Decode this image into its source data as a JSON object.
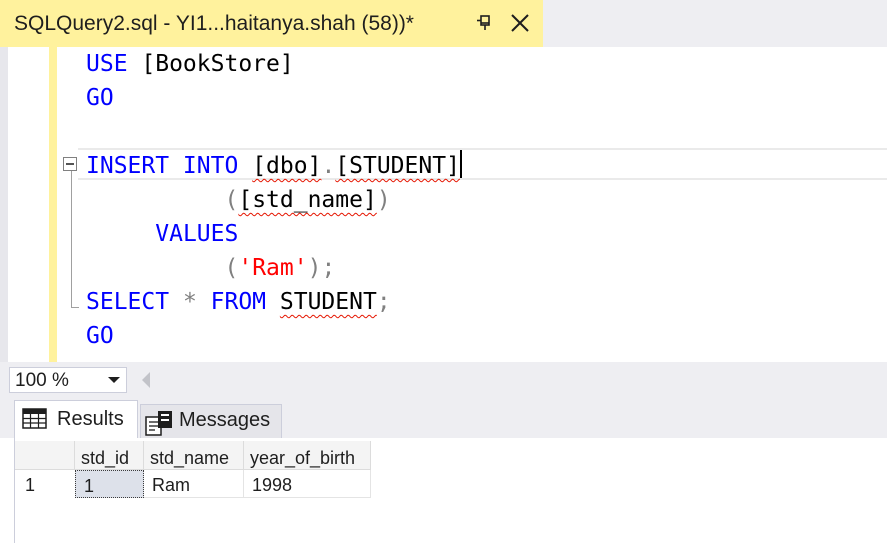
{
  "tab": {
    "title": "SQLQuery2.sql - YI1...haitanya.shah (58))*",
    "pin_icon": "pin-icon",
    "close_icon": "close-icon"
  },
  "editor": {
    "line1": {
      "kw": "USE",
      "rest": " [BookStore]"
    },
    "line2": {
      "kw": "GO"
    },
    "line4": {
      "kw": "INSERT INTO",
      "sp": " ",
      "obj1": "[dbo]",
      "dot": ".",
      "obj2": "[STUDENT]"
    },
    "line5": {
      "indent": "          ",
      "open": "(",
      "col": "[std_name]",
      "close": ")"
    },
    "line6": {
      "indent": "     ",
      "kw": "VALUES"
    },
    "line7": {
      "indent": "          ",
      "open": "(",
      "str": "'Ram'",
      "close": ");"
    },
    "line8": {
      "kw1": "SELECT",
      "star": " * ",
      "kw2": "FROM",
      "sp": " ",
      "obj": "STUDENT",
      "semi": ";"
    },
    "line9": {
      "kw": "GO"
    }
  },
  "zoom": {
    "value": "100 %"
  },
  "results": {
    "tab_results": "Results",
    "tab_messages": "Messages",
    "columns": [
      "std_id",
      "std_name",
      "year_of_birth"
    ],
    "rows": [
      {
        "row_number": "1",
        "cells": [
          "1",
          "Ram",
          "1998"
        ]
      }
    ]
  },
  "colors": {
    "tab_active": "#fff29d",
    "keyword": "#0000ff",
    "string": "#ff0000",
    "operator": "#808080",
    "squiggle": "#e51400"
  }
}
